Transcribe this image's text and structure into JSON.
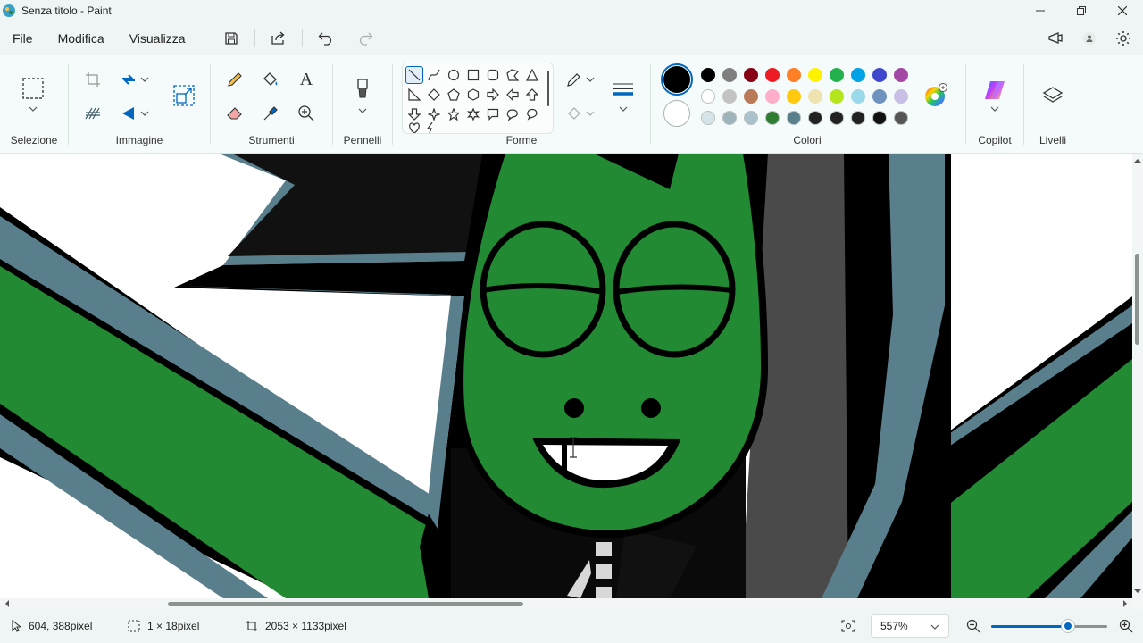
{
  "window": {
    "title": "Senza titolo - Paint"
  },
  "menu": {
    "file": "File",
    "modifica": "Modifica",
    "visualizza": "Visualizza"
  },
  "ribbon": {
    "selezione": "Selezione",
    "immagine": "Immagine",
    "strumenti": "Strumenti",
    "pennelli": "Pennelli",
    "forme": "Forme",
    "colori": "Colori",
    "copilot": "Copilot",
    "livelli": "Livelli",
    "text_tool_glyph": "A"
  },
  "colors": {
    "primary": "#000000",
    "secondary": "#ffffff",
    "palette": [
      [
        "#000000",
        "#7f7f7f",
        "#880015",
        "#ed1c24",
        "#ff7f27",
        "#fff200",
        "#22b14c",
        "#00a2e8",
        "#3f48cc",
        "#a349a4"
      ],
      [
        "#ffffff",
        "#c3c3c3",
        "#b97a57",
        "#ffaec9",
        "#ffc90e",
        "#efe4b0",
        "#b5e61d",
        "#99d9ea",
        "#7092be",
        "#c8bfe7"
      ],
      [
        "#d6e4ea",
        "#9fb3bb",
        "#a9c2cc",
        "#2e7d32",
        "#5a7f8c",
        "#222222",
        "#222222",
        "#222222",
        "#111111",
        "#555555"
      ]
    ],
    "accent": "#0067c0"
  },
  "status": {
    "cursor_pos": "604, 388pixel",
    "selection_size": "1 × 18pixel",
    "canvas_size": "2053 × 1133pixel",
    "zoom": "557%",
    "zoom_fraction": 0.66
  }
}
